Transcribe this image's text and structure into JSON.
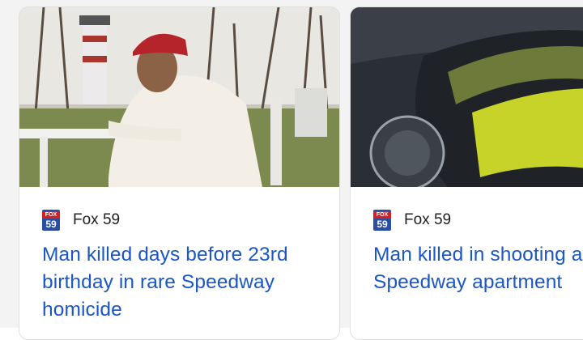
{
  "cards": [
    {
      "source": "Fox 59",
      "logo_text_top": "FOX",
      "logo_text_num": "59",
      "headline": "Man killed days before 23rd birthday in rare Speedway homicide"
    },
    {
      "source": "Fox 59",
      "logo_text_top": "FOX",
      "logo_text_num": "59",
      "headline": "Man killed in shooting at Speedway apartment"
    }
  ],
  "colors": {
    "headline": "#1a56c4",
    "source_text": "#202124",
    "card_border": "#e0e0e0"
  },
  "icons": [
    "fox59-logo"
  ]
}
